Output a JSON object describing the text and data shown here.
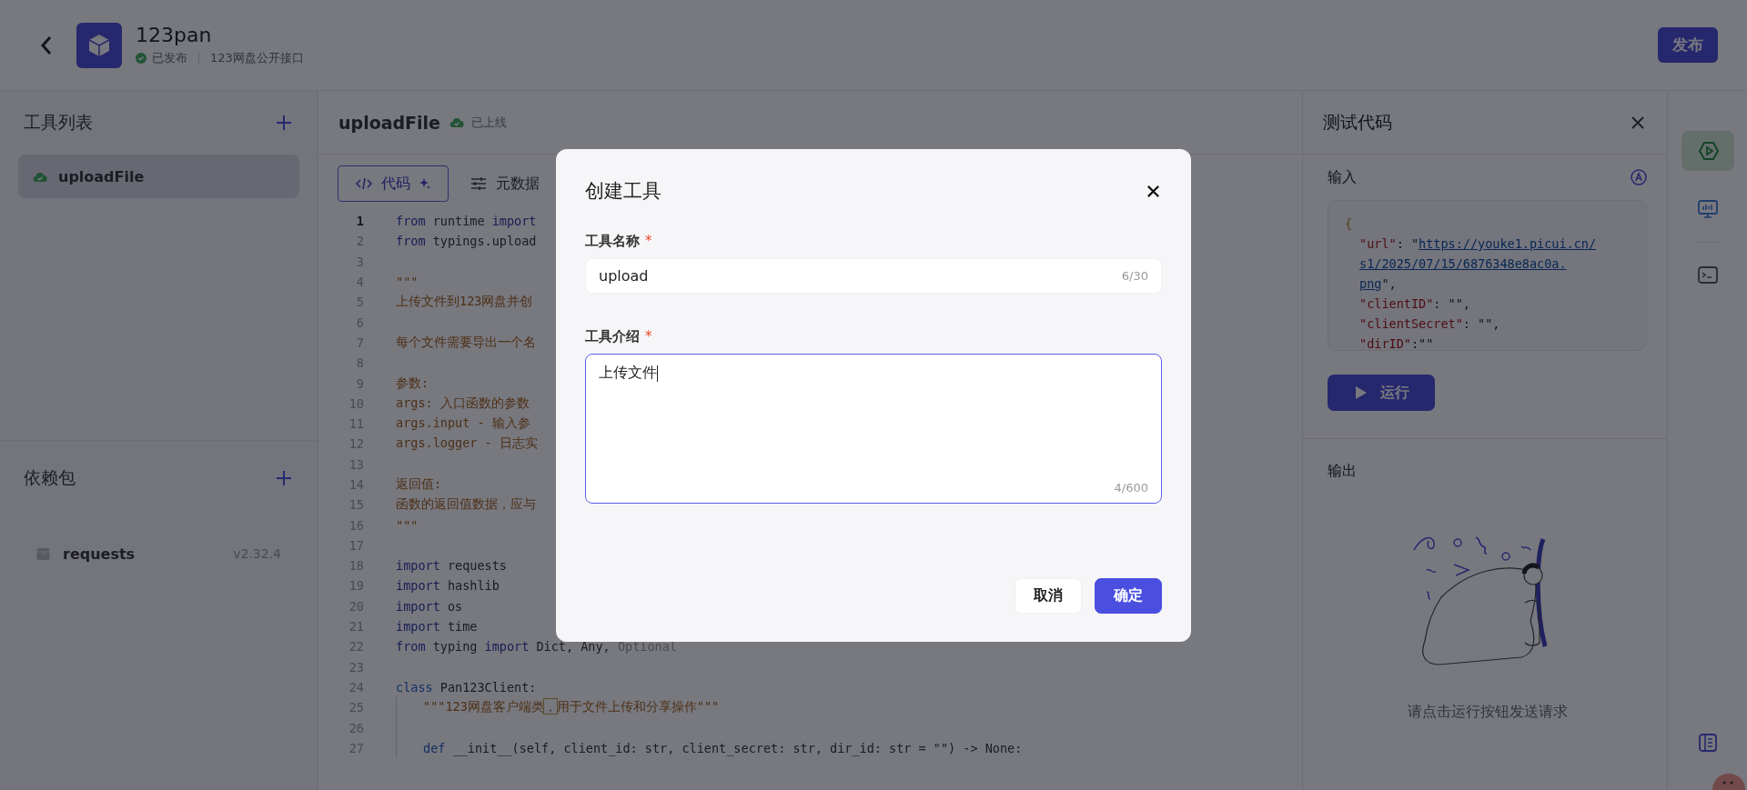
{
  "header": {
    "title": "123pan",
    "status": "已发布",
    "description": "123网盘公开接口",
    "publish_button": "发布"
  },
  "tools_panel": {
    "title": "工具列表",
    "items": [
      {
        "name": "uploadFile",
        "selected": true
      }
    ]
  },
  "dependencies_panel": {
    "title": "依赖包",
    "items": [
      {
        "name": "requests",
        "version": "v2.32.4"
      }
    ]
  },
  "editor": {
    "tool_name": "uploadFile",
    "status": "已上线",
    "tabs": [
      {
        "label": "代码",
        "kind": "code",
        "selected": true
      },
      {
        "label": "元数据",
        "kind": "meta",
        "selected": false
      }
    ],
    "lines": [
      {
        "number": "1",
        "current": true,
        "tokens": [
          {
            "text": "from",
            "kind": "keyword"
          },
          {
            "text": " runtime ",
            "kind": "plain"
          },
          {
            "text": "import",
            "kind": "keyword"
          }
        ]
      },
      {
        "number": "2",
        "current": false,
        "tokens": [
          {
            "text": "from",
            "kind": "keyword"
          },
          {
            "text": " typings.upload",
            "kind": "plain"
          }
        ]
      },
      {
        "number": "3",
        "current": false
      },
      {
        "number": "4",
        "current": false,
        "tokens": [
          {
            "text": "\"\"\"",
            "kind": "comment"
          }
        ]
      },
      {
        "number": "5",
        "current": false,
        "tokens": [
          {
            "text": "上传文件到123网盘并创",
            "kind": "comment"
          }
        ]
      },
      {
        "number": "6",
        "current": false
      },
      {
        "number": "7",
        "current": false,
        "tokens": [
          {
            "text": "每个文件需要导出一个名",
            "kind": "comment"
          }
        ]
      },
      {
        "number": "8",
        "current": false
      },
      {
        "number": "9",
        "current": false,
        "tokens": [
          {
            "text": "参数:",
            "kind": "comment"
          }
        ]
      },
      {
        "number": "10",
        "current": false,
        "tokens": [
          {
            "text": "args: 入口函数的参数",
            "kind": "comment"
          }
        ]
      },
      {
        "number": "11",
        "current": false,
        "tokens": [
          {
            "text": "args.input - 输入参",
            "kind": "comment"
          }
        ]
      },
      {
        "number": "12",
        "current": false,
        "tokens": [
          {
            "text": "args.logger - 日志实",
            "kind": "comment"
          }
        ]
      },
      {
        "number": "13",
        "current": false
      },
      {
        "number": "14",
        "current": false,
        "tokens": [
          {
            "text": "返回值:",
            "kind": "comment"
          }
        ]
      },
      {
        "number": "15",
        "current": false,
        "tokens": [
          {
            "text": "函数的返回值数据，应与",
            "kind": "comment"
          }
        ]
      },
      {
        "number": "16",
        "current": false,
        "tokens": [
          {
            "text": "\"\"\"",
            "kind": "comment"
          }
        ]
      },
      {
        "number": "17",
        "current": false
      },
      {
        "number": "18",
        "current": false,
        "tokens": [
          {
            "text": "import",
            "kind": "keyword"
          },
          {
            "text": " requests",
            "kind": "plain"
          }
        ]
      },
      {
        "number": "19",
        "current": false,
        "tokens": [
          {
            "text": "import",
            "kind": "keyword"
          },
          {
            "text": " hashlib",
            "kind": "plain"
          }
        ]
      },
      {
        "number": "20",
        "current": false,
        "tokens": [
          {
            "text": "import",
            "kind": "keyword"
          },
          {
            "text": " os",
            "kind": "plain"
          }
        ]
      },
      {
        "number": "21",
        "current": false,
        "tokens": [
          {
            "text": "import",
            "kind": "keyword"
          },
          {
            "text": " time",
            "kind": "plain"
          }
        ]
      },
      {
        "number": "22",
        "current": false,
        "tokens": [
          {
            "text": "from",
            "kind": "keyword"
          },
          {
            "text": " typing ",
            "kind": "plain"
          },
          {
            "text": "import",
            "kind": "keyword"
          },
          {
            "text": " Dict, Any, ",
            "kind": "plain"
          },
          {
            "text": "Optional",
            "kind": "unused"
          }
        ]
      },
      {
        "number": "23",
        "current": false
      },
      {
        "number": "24",
        "current": false,
        "tokens": [
          {
            "text": "class",
            "kind": "declare"
          },
          {
            "text": " Pan123Client:",
            "kind": "plain"
          }
        ]
      },
      {
        "number": "25",
        "current": false,
        "indented": true,
        "tokens": [
          {
            "text": "\"\"\"123网盘客户端类",
            "kind": "comment"
          },
          {
            "text": "，",
            "kind": "flagged"
          },
          {
            "text": "用于文件上传和分享操作\"\"\"",
            "kind": "comment"
          }
        ]
      },
      {
        "number": "26",
        "current": false,
        "indented": true
      },
      {
        "number": "27",
        "current": false,
        "indented": true,
        "tokens": [
          {
            "text": "def",
            "kind": "declare"
          },
          {
            "text": " __init__(self, client_id: str, client_secret: str, dir_id: str = \"\") -> None:",
            "kind": "plain"
          }
        ]
      }
    ]
  },
  "test_panel": {
    "title": "测试代码",
    "input_label": "输入",
    "input_lines": [
      {
        "indented": false,
        "tokens": [
          {
            "text": "{",
            "kind": "brace"
          }
        ]
      },
      {
        "indented": true,
        "tokens": [
          {
            "text": "\"url\"",
            "kind": "key"
          },
          {
            "text": ": \"",
            "kind": "plain"
          },
          {
            "text": "https://youke1.picui.cn/",
            "kind": "link"
          }
        ]
      },
      {
        "indented": true,
        "tokens": [
          {
            "text": "s1/2025/07/15/6876348e8ac0a.",
            "kind": "link"
          }
        ]
      },
      {
        "indented": true,
        "tokens": [
          {
            "text": "png",
            "kind": "link"
          },
          {
            "text": "\",",
            "kind": "plain"
          }
        ]
      },
      {
        "indented": true,
        "tokens": [
          {
            "text": "\"clientID\"",
            "kind": "key"
          },
          {
            "text": ": \"\",",
            "kind": "plain"
          }
        ]
      },
      {
        "indented": true,
        "tokens": [
          {
            "text": "\"clientSecret\"",
            "kind": "key"
          },
          {
            "text": ": \"\",",
            "kind": "plain"
          }
        ]
      },
      {
        "indented": true,
        "tokens": [
          {
            "text": "\"dirID\"",
            "kind": "key"
          },
          {
            "text": ":\"\"",
            "kind": "plain"
          }
        ]
      }
    ],
    "run_button": "运行",
    "output_label": "输出",
    "empty_message": "请点击运行按钮发送请求"
  },
  "side_bar": {
    "items": [
      {
        "kind": "run",
        "selected": true
      },
      {
        "kind": "monitor",
        "selected": false
      },
      {
        "kind": "terminal",
        "selected": false
      },
      {
        "kind": "docs",
        "selected": false
      }
    ]
  },
  "dialog": {
    "title": "创建工具",
    "fields": [
      {
        "label": "工具名称",
        "required_mark": "*",
        "kind": "input",
        "value": "upload",
        "counter": "6/30",
        "focused": false
      },
      {
        "label": "工具介绍",
        "required_mark": "*",
        "kind": "textarea",
        "value": "上传文件",
        "counter": "4/600",
        "focused": true
      }
    ],
    "buttons": [
      {
        "label": "取消",
        "kind": "secondary"
      },
      {
        "label": "确定",
        "kind": "primary"
      }
    ]
  }
}
